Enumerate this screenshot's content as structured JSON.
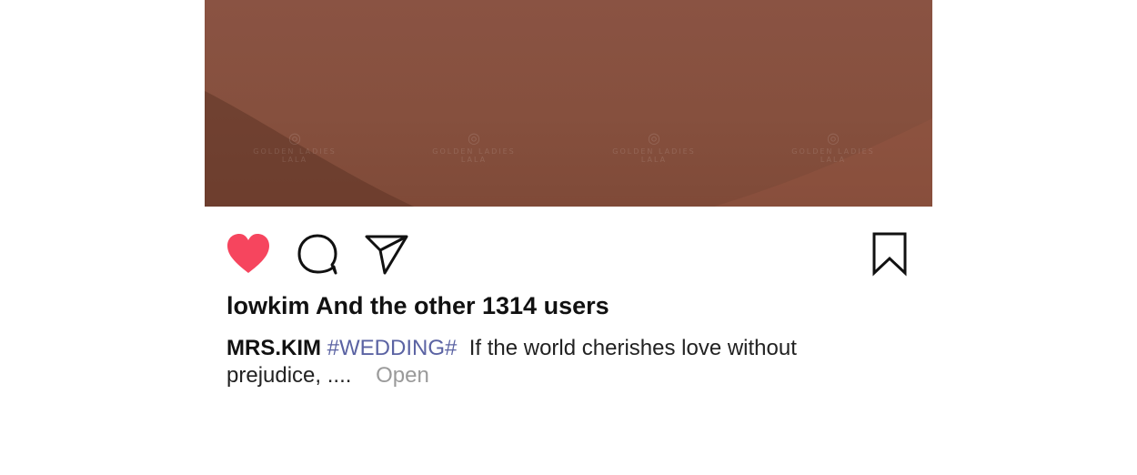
{
  "photo": {
    "background_color": "#86503e",
    "watermarks": [
      {
        "text": "GOLDEN LADIES",
        "subtext": "LALA"
      },
      {
        "text": "GOLDEN LADIES",
        "subtext": "LALA"
      },
      {
        "text": "GOLDEN LADIES",
        "subtext": "LALA"
      },
      {
        "text": "GOLDEN LADIES",
        "subtext": "LALA"
      }
    ]
  },
  "actions": {
    "like_icon": "heart-icon",
    "like_color": "#f6455e",
    "comment_icon": "comment-bubble-icon",
    "share_icon": "paper-plane-icon",
    "save_icon": "bookmark-icon"
  },
  "likes": {
    "text": "lowkim And the other 1314 users"
  },
  "caption": {
    "username": "MRS.KIM",
    "hashtag": "#WEDDING#",
    "text": "If the world cherishes love without prejudice, ....",
    "more_label": "Open"
  }
}
